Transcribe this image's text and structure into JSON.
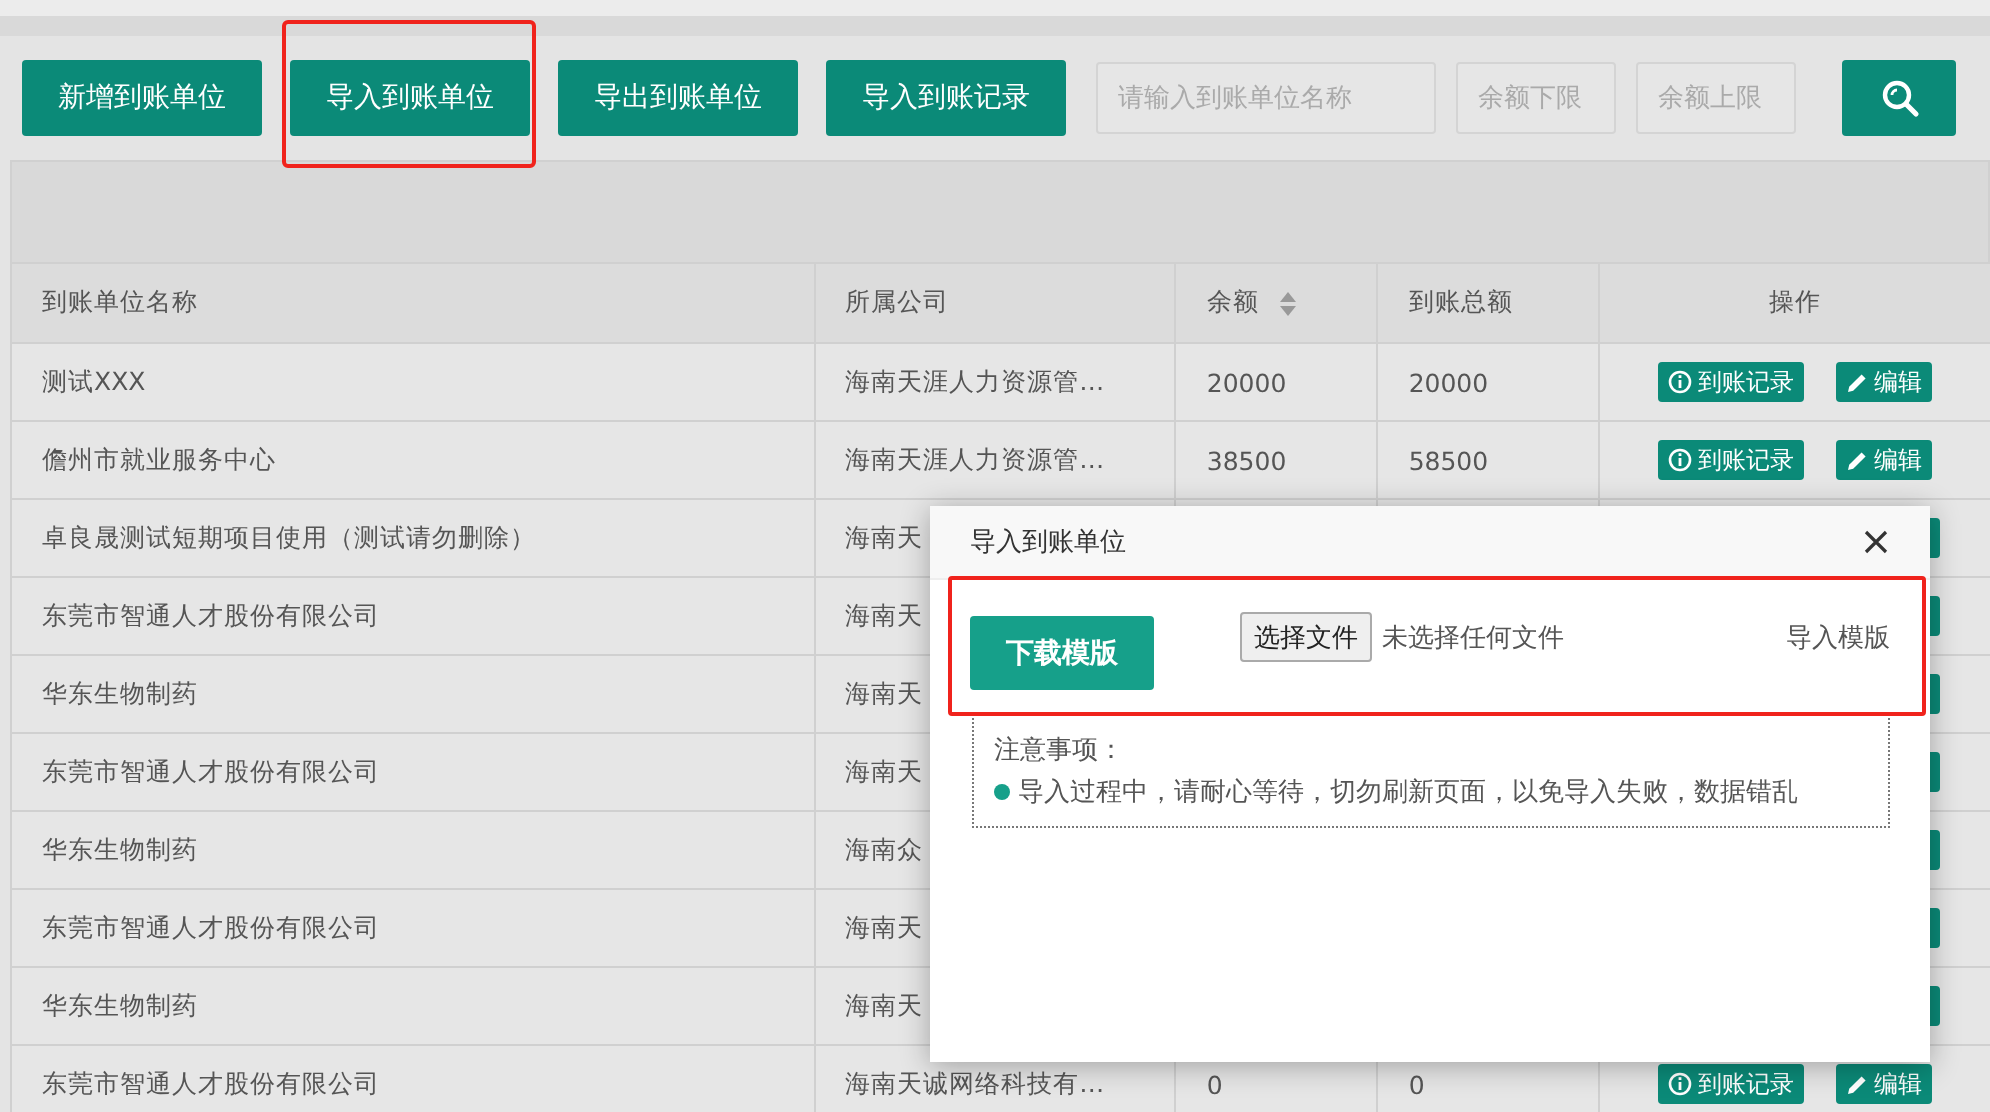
{
  "toolbar": {
    "buttons": [
      {
        "label": "新增到账单位",
        "highlighted": false
      },
      {
        "label": "导入到账单位",
        "highlighted": true
      },
      {
        "label": "导出到账单位",
        "highlighted": false
      },
      {
        "label": "导入到账记录",
        "highlighted": false
      }
    ],
    "fields": [
      {
        "placeholder": "请输入到账单位名称",
        "kind": "wide"
      },
      {
        "placeholder": "余额下限",
        "kind": "narrow"
      },
      {
        "placeholder": "余额上限",
        "kind": "narrow"
      }
    ]
  },
  "table": {
    "columns": [
      {
        "label": "到账单位名称",
        "sortable": false
      },
      {
        "label": "所属公司",
        "sortable": false
      },
      {
        "label": "余额",
        "sortable": true
      },
      {
        "label": "到账总额",
        "sortable": false
      },
      {
        "label": "操作",
        "sortable": false
      }
    ],
    "rows": [
      {
        "name": "测试XXX",
        "company": "海南天涯人力资源管…",
        "balance": "20000",
        "total": "20000",
        "covered": false,
        "actions": [
          {
            "kind": "records",
            "label": "到账记录"
          },
          {
            "kind": "edit",
            "label": "编辑"
          }
        ]
      },
      {
        "name": "儋州市就业服务中心",
        "company": "海南天涯人力资源管…",
        "balance": "38500",
        "total": "58500",
        "covered": false,
        "actions": [
          {
            "kind": "records",
            "label": "到账记录"
          },
          {
            "kind": "edit",
            "label": "编辑"
          }
        ]
      },
      {
        "name": "卓良晟测试短期项目使用（测试请勿删除）",
        "company": "海南天",
        "covered": true
      },
      {
        "name": "东莞市智通人才股份有限公司",
        "company": "海南天",
        "covered": true
      },
      {
        "name": "华东生物制药",
        "company": "海南天",
        "covered": true
      },
      {
        "name": "东莞市智通人才股份有限公司",
        "company": "海南天",
        "covered": true
      },
      {
        "name": "华东生物制药",
        "company": "海南众",
        "covered": true
      },
      {
        "name": "东莞市智通人才股份有限公司",
        "company": "海南天",
        "covered": true
      },
      {
        "name": "华东生物制药",
        "company": "海南天",
        "covered": true
      },
      {
        "name": "东莞市智通人才股份有限公司",
        "company": "海南天诚网络科技有…",
        "balance": "0",
        "total": "0",
        "covered": false,
        "actions": [
          {
            "kind": "records",
            "label": "到账记录"
          },
          {
            "kind": "edit",
            "label": "编辑"
          }
        ]
      }
    ]
  },
  "modal": {
    "title": "导入到账单位",
    "highlighted": true,
    "download_button": "下载模版",
    "file_button": "选择文件",
    "file_status": "未选择任何文件",
    "template_label": "导入模版",
    "notes_title": "注意事项：",
    "notes": [
      "导入过程中，请耐心等待，切勿刷新页面，以免导入失败，数据错乱"
    ]
  }
}
